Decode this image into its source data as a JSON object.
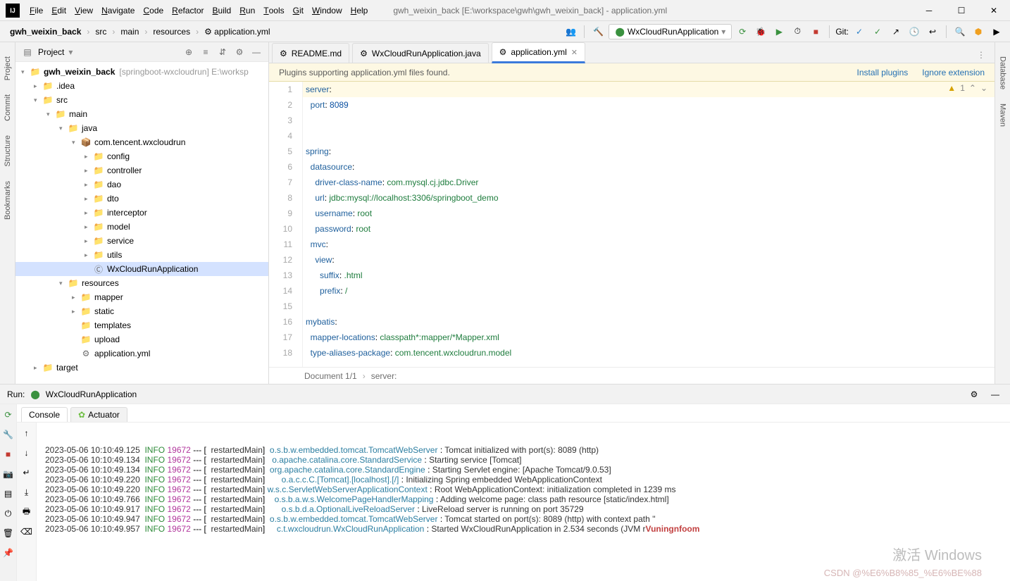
{
  "window_title": "gwh_weixin_back [E:\\workspace\\gwh\\gwh_weixin_back] - application.yml",
  "menu": [
    "File",
    "Edit",
    "View",
    "Navigate",
    "Code",
    "Refactor",
    "Build",
    "Run",
    "Tools",
    "Git",
    "Window",
    "Help"
  ],
  "breadcrumbs": [
    "gwh_weixin_back",
    "src",
    "main",
    "resources",
    "application.yml"
  ],
  "run_config": "WxCloudRunApplication",
  "git_label": "Git:",
  "project_panel": {
    "title": "Project",
    "root": {
      "name": "gwh_weixin_back",
      "hint": "[springboot-wxcloudrun]",
      "extra": "E:\\worksp"
    },
    "tree": [
      {
        "indent": 0,
        "exp": "▾",
        "icon": "📁",
        "cls": "folder-icon blue",
        "label": "gwh_weixin_back",
        "hint": "[springboot-wxcloudrun]  E:\\worksp",
        "bold": true
      },
      {
        "indent": 1,
        "exp": "▸",
        "icon": "📁",
        "cls": "folder-icon",
        "label": ".idea"
      },
      {
        "indent": 1,
        "exp": "▾",
        "icon": "📁",
        "cls": "folder-icon blue",
        "label": "src"
      },
      {
        "indent": 2,
        "exp": "▾",
        "icon": "📁",
        "cls": "folder-icon blue",
        "label": "main"
      },
      {
        "indent": 3,
        "exp": "▾",
        "icon": "📁",
        "cls": "folder-icon blue",
        "label": "java"
      },
      {
        "indent": 4,
        "exp": "▾",
        "icon": "📦",
        "cls": "file-icon",
        "label": "com.tencent.wxcloudrun"
      },
      {
        "indent": 5,
        "exp": "▸",
        "icon": "📁",
        "cls": "folder-icon",
        "label": "config"
      },
      {
        "indent": 5,
        "exp": "▸",
        "icon": "📁",
        "cls": "folder-icon",
        "label": "controller"
      },
      {
        "indent": 5,
        "exp": "▸",
        "icon": "📁",
        "cls": "folder-icon",
        "label": "dao"
      },
      {
        "indent": 5,
        "exp": "▸",
        "icon": "📁",
        "cls": "folder-icon",
        "label": "dto"
      },
      {
        "indent": 5,
        "exp": "▸",
        "icon": "📁",
        "cls": "folder-icon",
        "label": "interceptor"
      },
      {
        "indent": 5,
        "exp": "▸",
        "icon": "📁",
        "cls": "folder-icon",
        "label": "model"
      },
      {
        "indent": 5,
        "exp": "▸",
        "icon": "📁",
        "cls": "folder-icon",
        "label": "service"
      },
      {
        "indent": 5,
        "exp": "▸",
        "icon": "📁",
        "cls": "folder-icon",
        "label": "utils"
      },
      {
        "indent": 5,
        "exp": "",
        "icon": "Ⓒ",
        "cls": "file-icon",
        "label": "WxCloudRunApplication",
        "sel": true
      },
      {
        "indent": 3,
        "exp": "▾",
        "icon": "📁",
        "cls": "folder-icon blue",
        "label": "resources"
      },
      {
        "indent": 4,
        "exp": "▸",
        "icon": "📁",
        "cls": "folder-icon",
        "label": "mapper"
      },
      {
        "indent": 4,
        "exp": "▸",
        "icon": "📁",
        "cls": "folder-icon",
        "label": "static"
      },
      {
        "indent": 4,
        "exp": "",
        "icon": "📁",
        "cls": "folder-icon",
        "label": "templates"
      },
      {
        "indent": 4,
        "exp": "",
        "icon": "📁",
        "cls": "folder-icon",
        "label": "upload"
      },
      {
        "indent": 4,
        "exp": "",
        "icon": "⚙",
        "cls": "file-icon",
        "label": "application.yml"
      },
      {
        "indent": 1,
        "exp": "▸",
        "icon": "📁",
        "cls": "folder-icon",
        "label": "target",
        "target": true
      }
    ]
  },
  "editor": {
    "tabs": [
      {
        "label": "README.md"
      },
      {
        "label": "WxCloudRunApplication.java"
      },
      {
        "label": "application.yml",
        "active": true,
        "closable": true
      }
    ],
    "banner": {
      "text": "Plugins supporting application.yml files found.",
      "install": "Install plugins",
      "ignore": "Ignore extension"
    },
    "inspection": {
      "warn_count": "1"
    },
    "lines": [
      {
        "n": 1,
        "hl": true,
        "html": "<span class='k'>server</span>:"
      },
      {
        "n": 2,
        "html": "  <span class='k'>port</span>: <span class='n'>8089</span>"
      },
      {
        "n": 3,
        "html": ""
      },
      {
        "n": 4,
        "html": ""
      },
      {
        "n": 5,
        "html": "<span class='k'>spring</span>:"
      },
      {
        "n": 6,
        "html": "  <span class='k'>datasource</span>:"
      },
      {
        "n": 7,
        "html": "    <span class='k'>driver-class-name</span>: <span class='v'>com.mysql.cj.jdbc.Driver</span>"
      },
      {
        "n": 8,
        "html": "    <span class='k'>url</span>: <span class='v'>jdbc:mysql://localhost:3306/springboot_demo</span>"
      },
      {
        "n": 9,
        "html": "    <span class='k'>username</span>: <span class='v'>root</span>"
      },
      {
        "n": 10,
        "html": "    <span class='k'>password</span>: <span class='v'>root</span>"
      },
      {
        "n": 11,
        "html": "  <span class='k'>mvc</span>:"
      },
      {
        "n": 12,
        "html": "    <span class='k'>view</span>:"
      },
      {
        "n": 13,
        "html": "      <span class='k'>suffix</span>: <span class='v'>.html</span>"
      },
      {
        "n": 14,
        "html": "      <span class='k'>prefix</span>: <span class='v'>/</span>"
      },
      {
        "n": 15,
        "html": ""
      },
      {
        "n": 16,
        "html": "<span class='k'>mybatis</span>:"
      },
      {
        "n": 17,
        "html": "  <span class='k'>mapper-locations</span>: <span class='v'>classpath*:mapper/*Mapper.xml</span>"
      },
      {
        "n": 18,
        "html": "  <span class='k'>type-aliases-package</span>: <span class='v'>com.tencent.wxcloudrun.model</span>"
      }
    ],
    "status": {
      "doc": "Document 1/1",
      "path": "server:"
    }
  },
  "run": {
    "title": "Run:",
    "config": "WxCloudRunApplication",
    "tabs": [
      "Console",
      "Actuator"
    ],
    "logs": [
      {
        "t": "2023-05-06 10:10:49.125",
        "lv": "INFO",
        "pid": "19672",
        "th": "restartedMain",
        "lg": "o.s.b.w.embedded.tomcat.TomcatWebServer",
        "msg": "Tomcat initialized with port(s): 8089 (http)"
      },
      {
        "t": "2023-05-06 10:10:49.134",
        "lv": "INFO",
        "pid": "19672",
        "th": "restartedMain",
        "lg": "o.apache.catalina.core.StandardService",
        "msg": "Starting service [Tomcat]"
      },
      {
        "t": "2023-05-06 10:10:49.134",
        "lv": "INFO",
        "pid": "19672",
        "th": "restartedMain",
        "lg": "org.apache.catalina.core.StandardEngine",
        "msg": "Starting Servlet engine: [Apache Tomcat/9.0.53]"
      },
      {
        "t": "2023-05-06 10:10:49.220",
        "lv": "INFO",
        "pid": "19672",
        "th": "restartedMain",
        "lg": "o.a.c.c.C.[Tomcat].[localhost].[/]",
        "msg": "Initializing Spring embedded WebApplicationContext"
      },
      {
        "t": "2023-05-06 10:10:49.220",
        "lv": "INFO",
        "pid": "19672",
        "th": "restartedMain",
        "lg": "w.s.c.ServletWebServerApplicationContext",
        "msg": "Root WebApplicationContext: initialization completed in 1239 ms"
      },
      {
        "t": "2023-05-06 10:10:49.766",
        "lv": "INFO",
        "pid": "19672",
        "th": "restartedMain",
        "lg": "o.s.b.a.w.s.WelcomePageHandlerMapping",
        "msg": "Adding welcome page: class path resource [static/index.html]"
      },
      {
        "t": "2023-05-06 10:10:49.917",
        "lv": "INFO",
        "pid": "19672",
        "th": "restartedMain",
        "lg": "o.s.b.d.a.OptionalLiveReloadServer",
        "msg": "LiveReload server is running on port 35729"
      },
      {
        "t": "2023-05-06 10:10:49.947",
        "lv": "INFO",
        "pid": "19672",
        "th": "restartedMain",
        "lg": "o.s.b.w.embedded.tomcat.TomcatWebServer",
        "msg": "Tomcat started on port(s): 8089 (http) with context path ''"
      },
      {
        "t": "2023-05-06 10:10:49.957",
        "lv": "INFO",
        "pid": "19672",
        "th": "restartedMain",
        "lg": "c.t.wxcloudrun.WxCloudRunApplication",
        "msg": "Started WxCloudRunApplication in 2.534 seconds (JVM r"
      }
    ],
    "tail_overlay": "Vuningnfoom"
  },
  "watermark1": "激活 Windows",
  "watermark2": "CSDN @%E6%B8%85_%E6%BE%88",
  "gutters": {
    "left": [
      "Project",
      "Commit",
      "Structure",
      "Bookmarks"
    ],
    "right": [
      "Database",
      "Maven"
    ]
  }
}
